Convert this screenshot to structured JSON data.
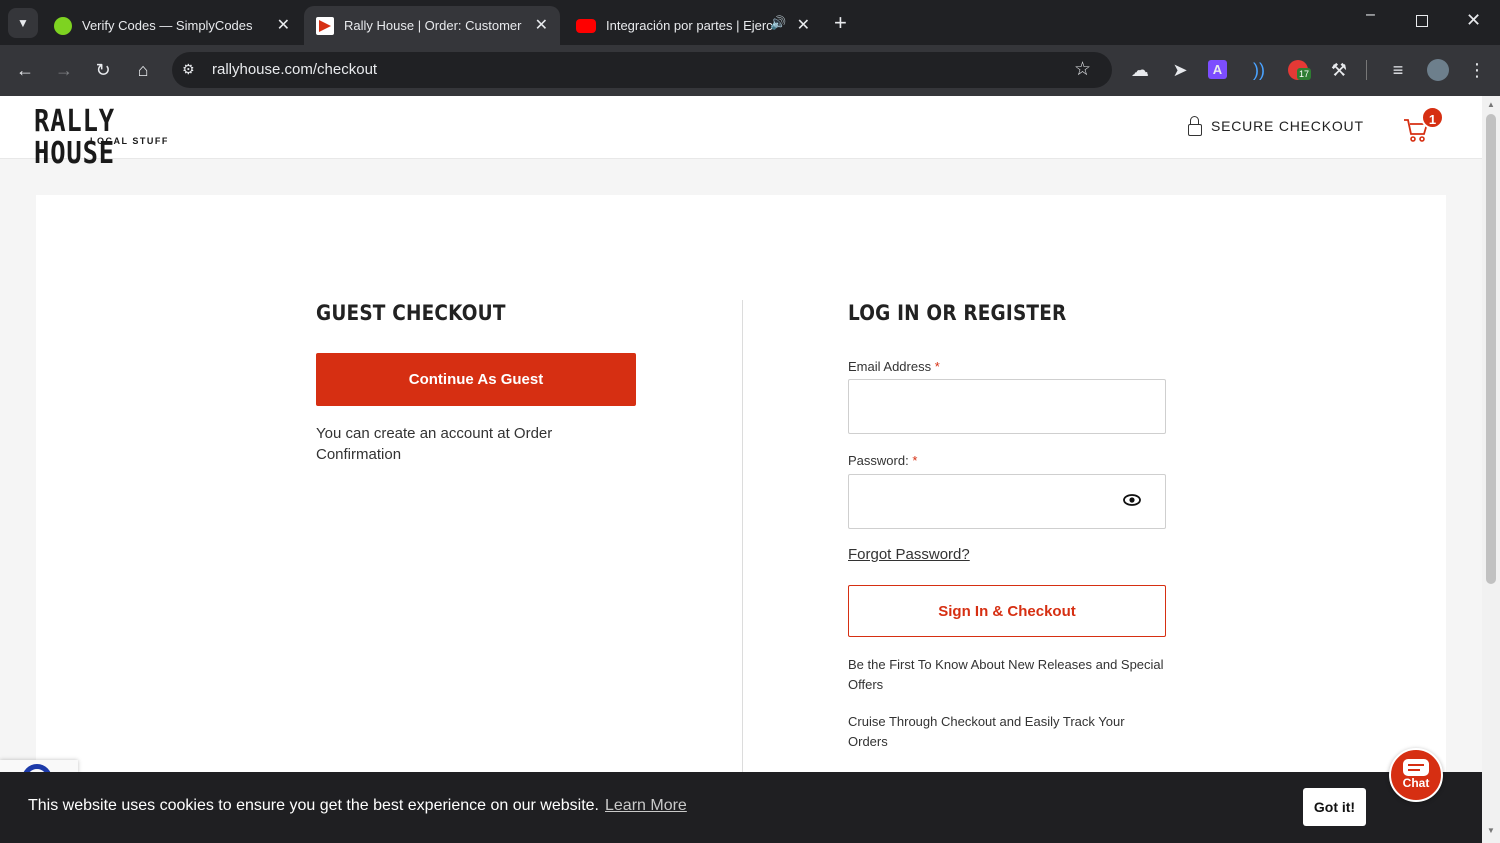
{
  "browser": {
    "tabs": [
      {
        "title": "Verify Codes — SimplyCodes",
        "favicon_color": "#7ed321",
        "active": false
      },
      {
        "title": "Rally House | Order: Customer I",
        "favicon_color": "#d62f12",
        "active": true
      },
      {
        "title": "Integración por partes | Ejerc",
        "favicon_color": "#ff0000",
        "active": false
      }
    ],
    "url": "rallyhouse.com/checkout",
    "extension_badge": "17"
  },
  "header": {
    "logo_main": "RALLY HOUSE",
    "logo_sub": "LOCAL STUFF",
    "secure_checkout": "SECURE CHECKOUT",
    "cart_count": "1"
  },
  "guest": {
    "heading": "GUEST CHECKOUT",
    "button": "Continue As Guest",
    "note": "You can create an account at Order Confirmation"
  },
  "login": {
    "heading": "LOG IN OR REGISTER",
    "email_label": "Email Address",
    "password_label": "Password:",
    "required_mark": "*",
    "forgot": "Forgot Password?",
    "signin_button": "Sign In & Checkout",
    "benefit1": "Be the First To Know About New Releases and Special Offers",
    "benefit2": "Cruise Through Checkout and Easily Track Your Orders"
  },
  "cookie": {
    "message": "This website uses cookies to ensure you get the best experience on our website.",
    "learn_more": "Learn More",
    "got_it": "Got it!"
  },
  "chat": {
    "label": "Chat"
  },
  "colors": {
    "brand_red": "#d62f12"
  }
}
